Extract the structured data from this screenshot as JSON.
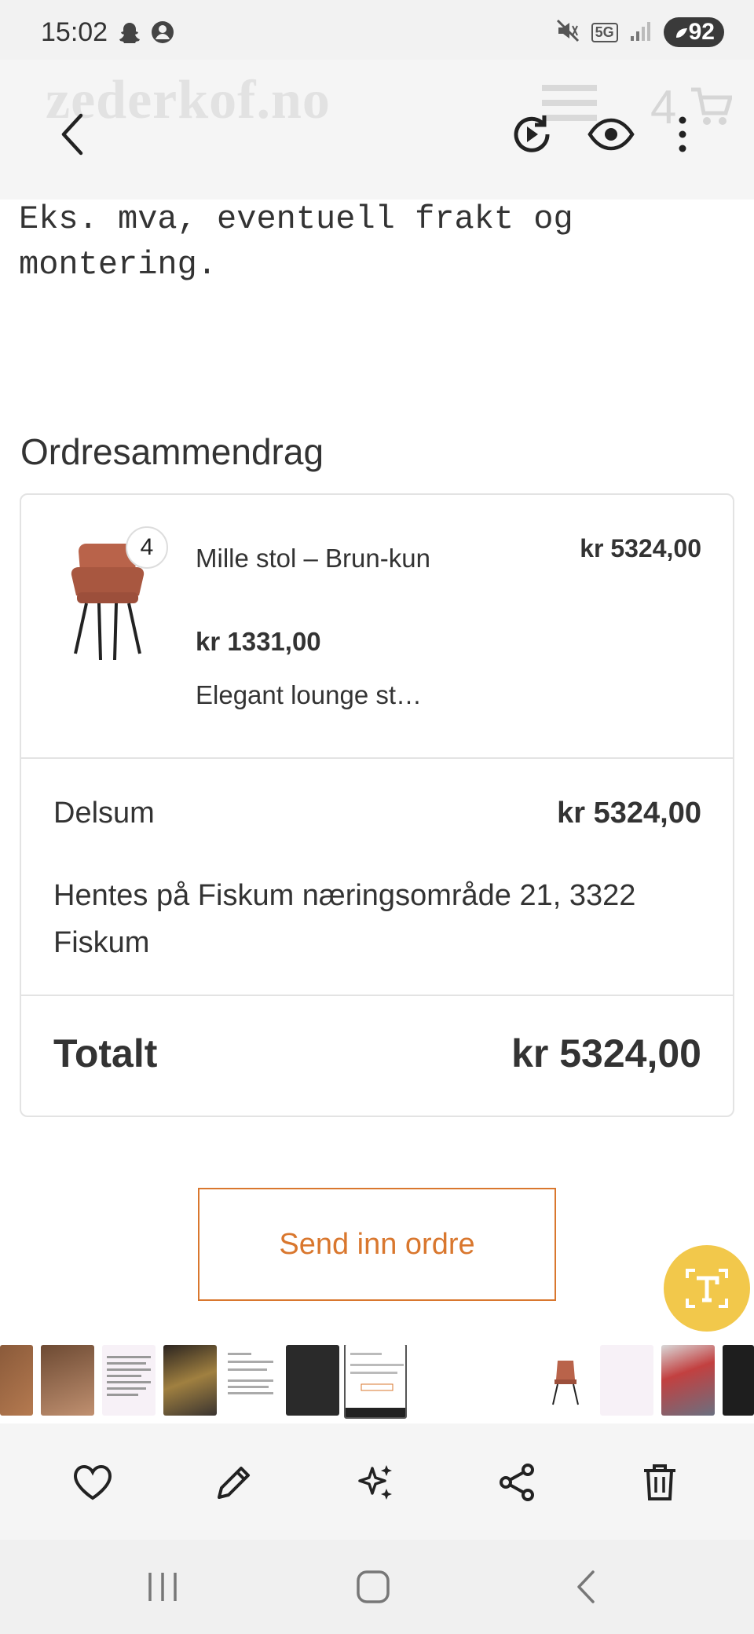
{
  "status_bar": {
    "time": "15:02",
    "battery": "92",
    "network": "5G"
  },
  "viewer": {
    "site_logo": "zederkof.no",
    "cart_count": "4"
  },
  "page": {
    "tax_note": "Eks. mva, eventuell frakt og montering.",
    "section_title": "Ordresammendrag"
  },
  "order": {
    "item": {
      "quantity": "4",
      "name": "Mille stol – Brun-kun",
      "total": "kr 5324,00",
      "unit_price": "kr 1331,00",
      "description": "Elegant lounge st…"
    },
    "subtotal_label": "Delsum",
    "subtotal_value": "kr 5324,00",
    "pickup_note": "Hentes på Fiskum næringsområde 21, 3322 Fiskum",
    "total_label": "Totalt",
    "total_value": "kr 5324,00"
  },
  "actions": {
    "submit_label": "Send inn ordre"
  },
  "colors": {
    "accent": "#d9772e",
    "text_extract": "#f2c84b"
  }
}
